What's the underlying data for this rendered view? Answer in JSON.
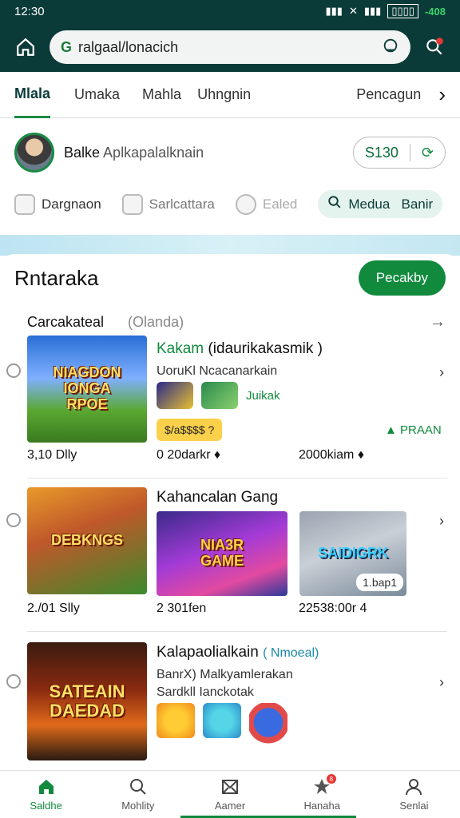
{
  "status": {
    "time": "12:30",
    "battery_text": "-408"
  },
  "browser": {
    "url": "ralgaal/lonacich",
    "url_prefix": "G"
  },
  "tabs": [
    {
      "label": "Mlala",
      "active": true
    },
    {
      "label": "Umaka"
    },
    {
      "label": "Mahla"
    },
    {
      "label": "Uhngnin"
    },
    {
      "label": "Pencagun"
    }
  ],
  "profile": {
    "name": "Balke",
    "subtitle": "Aplkapalalknain",
    "balance": "S130"
  },
  "actions": [
    {
      "label": "Dargnaon",
      "icon": "document-icon"
    },
    {
      "label": "Sarlcattara",
      "icon": "chat-icon"
    },
    {
      "label": "Ealed",
      "icon": "camera-icon"
    },
    {
      "label": "Medua   Banir",
      "icon": "search-icon"
    }
  ],
  "main": {
    "title": "Rntaraka",
    "cta": "Pecakby",
    "subheading": "Carcakateal",
    "subheading_tag": "(Olanda)"
  },
  "items": [
    {
      "title": "Kakam",
      "title_extra": "(idaurikakasmik )",
      "desc1": "UoruKl Ncacanarkain",
      "art_text": "NIAGDON\nIONGA\nRPOE",
      "mini_label": "Juikak",
      "rating": "$/a$$$$ ?",
      "badge": "▲ PRAAN",
      "stats": [
        "3,10 Dlly",
        "0 20darkr ♦",
        "2000kiam ♦"
      ]
    },
    {
      "title": "Kahancalan Gang",
      "art_text": "DEBKNGS",
      "art2_text": "NIA3R\nGAME",
      "art3_text": "SAIDIGRK",
      "tag": "1.bap1",
      "stats": [
        "2./01 Slly",
        "2 301fen",
        "22538:00r 4"
      ]
    },
    {
      "title": "Kalapaolialkain",
      "title_extra": "( Nmoeal)",
      "desc1": "BanrX) Malkyamlerakan",
      "desc2": "Sardkll Ianckotak",
      "art_text": "SATEAIN\nDAEDAD"
    }
  ],
  "bottom_nav": [
    {
      "label": "Saldhe",
      "icon": "home-icon",
      "active": true
    },
    {
      "label": "Mohlity",
      "icon": "search-icon"
    },
    {
      "label": "Aamer",
      "icon": "mail-icon"
    },
    {
      "label": "Hanaha",
      "icon": "star-icon",
      "badge": "8"
    },
    {
      "label": "Senlai",
      "icon": "person-icon"
    }
  ],
  "colors": {
    "brand": "#118a3e",
    "header": "#0b3b38"
  }
}
